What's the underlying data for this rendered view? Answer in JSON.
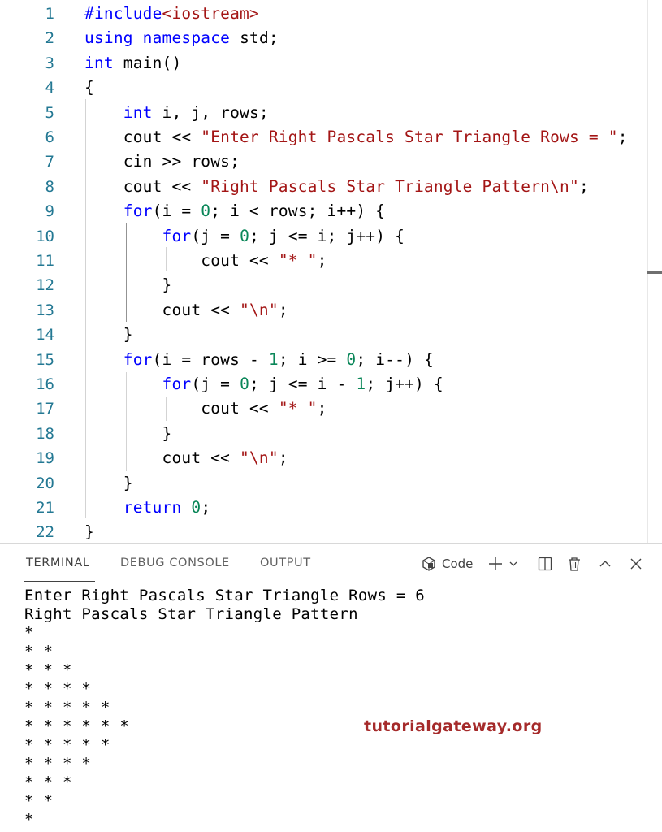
{
  "editor": {
    "lines": [
      {
        "num": "1",
        "tokens": [
          {
            "t": "#include",
            "c": "pp"
          },
          {
            "t": "<iostream>",
            "c": "str"
          }
        ]
      },
      {
        "num": "2",
        "tokens": [
          {
            "t": "using",
            "c": "kw"
          },
          {
            "t": " "
          },
          {
            "t": "namespace",
            "c": "kw"
          },
          {
            "t": " std;"
          }
        ]
      },
      {
        "num": "3",
        "tokens": [
          {
            "t": "int",
            "c": "kw"
          },
          {
            "t": " main()"
          }
        ]
      },
      {
        "num": "4",
        "tokens": [
          {
            "t": "{"
          }
        ]
      },
      {
        "num": "5",
        "tokens": [
          {
            "t": "    "
          },
          {
            "t": "int",
            "c": "kw"
          },
          {
            "t": " i, j, rows;"
          }
        ]
      },
      {
        "num": "6",
        "tokens": [
          {
            "t": "    cout << "
          },
          {
            "t": "\"Enter Right Pascals Star Triangle Rows = \"",
            "c": "str"
          },
          {
            "t": ";"
          }
        ]
      },
      {
        "num": "7",
        "tokens": [
          {
            "t": "    cin >> rows;"
          }
        ]
      },
      {
        "num": "8",
        "tokens": [
          {
            "t": "    cout << "
          },
          {
            "t": "\"Right Pascals Star Triangle Pattern\\n\"",
            "c": "str"
          },
          {
            "t": ";"
          }
        ]
      },
      {
        "num": "9",
        "tokens": [
          {
            "t": "    "
          },
          {
            "t": "for",
            "c": "kw"
          },
          {
            "t": "(i = "
          },
          {
            "t": "0",
            "c": "num"
          },
          {
            "t": "; i < rows; i++) {"
          }
        ]
      },
      {
        "num": "10",
        "tokens": [
          {
            "t": "        "
          },
          {
            "t": "for",
            "c": "kw"
          },
          {
            "t": "(j = "
          },
          {
            "t": "0",
            "c": "num"
          },
          {
            "t": "; j <= i; j++) {"
          }
        ]
      },
      {
        "num": "11",
        "tokens": [
          {
            "t": "            cout << "
          },
          {
            "t": "\"* \"",
            "c": "str"
          },
          {
            "t": ";"
          }
        ]
      },
      {
        "num": "12",
        "tokens": [
          {
            "t": "        }"
          }
        ]
      },
      {
        "num": "13",
        "tokens": [
          {
            "t": "        cout << "
          },
          {
            "t": "\"\\n\"",
            "c": "str"
          },
          {
            "t": ";"
          }
        ]
      },
      {
        "num": "14",
        "tokens": [
          {
            "t": "    }"
          }
        ]
      },
      {
        "num": "15",
        "tokens": [
          {
            "t": "    "
          },
          {
            "t": "for",
            "c": "kw"
          },
          {
            "t": "(i = rows - "
          },
          {
            "t": "1",
            "c": "num"
          },
          {
            "t": "; i >= "
          },
          {
            "t": "0",
            "c": "num"
          },
          {
            "t": "; i--) {"
          }
        ]
      },
      {
        "num": "16",
        "tokens": [
          {
            "t": "        "
          },
          {
            "t": "for",
            "c": "kw"
          },
          {
            "t": "(j = "
          },
          {
            "t": "0",
            "c": "num"
          },
          {
            "t": "; j <= i - "
          },
          {
            "t": "1",
            "c": "num"
          },
          {
            "t": "; j++) {"
          }
        ]
      },
      {
        "num": "17",
        "tokens": [
          {
            "t": "            cout << "
          },
          {
            "t": "\"* \"",
            "c": "str"
          },
          {
            "t": ";"
          }
        ]
      },
      {
        "num": "18",
        "tokens": [
          {
            "t": "        }"
          }
        ]
      },
      {
        "num": "19",
        "tokens": [
          {
            "t": "        cout << "
          },
          {
            "t": "\"\\n\"",
            "c": "str"
          },
          {
            "t": ";"
          }
        ]
      },
      {
        "num": "20",
        "tokens": [
          {
            "t": "    }"
          }
        ]
      },
      {
        "num": "21",
        "tokens": [
          {
            "t": "    "
          },
          {
            "t": "return",
            "c": "kw"
          },
          {
            "t": " "
          },
          {
            "t": "0",
            "c": "num"
          },
          {
            "t": ";"
          }
        ]
      },
      {
        "num": "22",
        "tokens": [
          {
            "t": "}"
          }
        ]
      }
    ]
  },
  "panel": {
    "tabs": [
      "TERMINAL",
      "DEBUG CONSOLE",
      "OUTPUT"
    ],
    "active_tab": "TERMINAL",
    "toolbar": {
      "code_label": "Code",
      "icons": [
        "terminal-shell-icon",
        "plus-icon",
        "chevron-down-icon",
        "split-icon",
        "trash-icon",
        "chevron-up-icon",
        "close-icon"
      ]
    }
  },
  "terminal": {
    "lines": [
      "Enter Right Pascals Star Triangle Rows = 6",
      "Right Pascals Star Triangle Pattern",
      "*",
      "* *",
      "* * *",
      "* * * *",
      "* * * * *",
      "* * * * * *",
      "* * * * *",
      "* * * *",
      "* * *",
      "* *",
      "*"
    ]
  },
  "watermark": {
    "text": "tutorialgateway.org",
    "color": "#a52a2a"
  },
  "colors": {
    "keyword": "#0000ff",
    "string": "#a31515",
    "number": "#098658",
    "line_number": "#237893"
  }
}
